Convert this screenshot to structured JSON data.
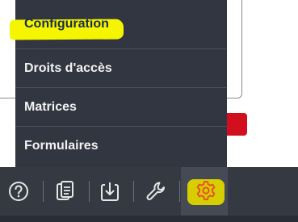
{
  "menu": {
    "items": [
      {
        "label": "Configuration"
      },
      {
        "label": "Droits d'accès"
      },
      {
        "label": "Matrices"
      },
      {
        "label": "Formulaires"
      }
    ]
  },
  "toolbar": {
    "icons": [
      "help-icon",
      "document-icon",
      "download-icon",
      "wrench-icon",
      "gear-icon"
    ],
    "active": "gear-icon"
  },
  "colors": {
    "menu_bg": "#323640",
    "toolbar_bg": "#353942",
    "highlight": "#f5f500",
    "gear_accent": "#e8532a",
    "red_button": "#d2101d"
  }
}
